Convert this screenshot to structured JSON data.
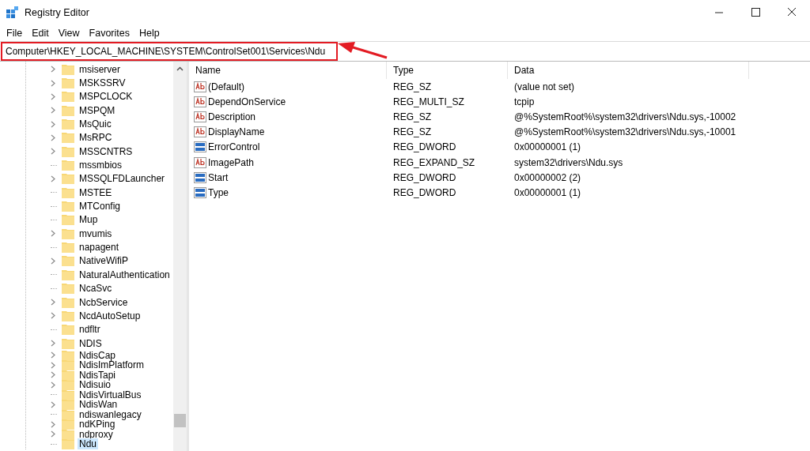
{
  "window": {
    "title": "Registry Editor"
  },
  "menu": [
    "File",
    "Edit",
    "View",
    "Favorites",
    "Help"
  ],
  "address": "Computer\\HKEY_LOCAL_MACHINE\\SYSTEM\\ControlSet001\\Services\\Ndu",
  "tree": [
    {
      "label": "msiserver",
      "expandable": true,
      "selected": false
    },
    {
      "label": "MSKSSRV",
      "expandable": true,
      "selected": false
    },
    {
      "label": "MSPCLOCK",
      "expandable": true,
      "selected": false
    },
    {
      "label": "MSPQM",
      "expandable": true,
      "selected": false
    },
    {
      "label": "MsQuic",
      "expandable": true,
      "selected": false
    },
    {
      "label": "MsRPC",
      "expandable": true,
      "selected": false
    },
    {
      "label": "MSSCNTRS",
      "expandable": true,
      "selected": false
    },
    {
      "label": "mssmbios",
      "expandable": false,
      "selected": false
    },
    {
      "label": "MSSQLFDLauncher",
      "expandable": true,
      "selected": false
    },
    {
      "label": "MSTEE",
      "expandable": false,
      "selected": false
    },
    {
      "label": "MTConfig",
      "expandable": false,
      "selected": false
    },
    {
      "label": "Mup",
      "expandable": false,
      "selected": false
    },
    {
      "label": "mvumis",
      "expandable": true,
      "selected": false
    },
    {
      "label": "napagent",
      "expandable": false,
      "selected": false
    },
    {
      "label": "NativeWifiP",
      "expandable": true,
      "selected": false
    },
    {
      "label": "NaturalAuthentication",
      "expandable": false,
      "selected": false
    },
    {
      "label": "NcaSvc",
      "expandable": false,
      "selected": false
    },
    {
      "label": "NcbService",
      "expandable": true,
      "selected": false
    },
    {
      "label": "NcdAutoSetup",
      "expandable": true,
      "selected": false
    },
    {
      "label": "ndfltr",
      "expandable": false,
      "selected": false
    },
    {
      "label": "NDIS",
      "expandable": true,
      "selected": false
    },
    {
      "label": "NdisCap",
      "expandable": true,
      "selected": false
    },
    {
      "label": "NdisImPlatform",
      "expandable": true,
      "selected": false
    },
    {
      "label": "NdisTapi",
      "expandable": true,
      "selected": false
    },
    {
      "label": "Ndisuio",
      "expandable": true,
      "selected": false
    },
    {
      "label": "NdisVirtualBus",
      "expandable": false,
      "selected": false
    },
    {
      "label": "NdisWan",
      "expandable": true,
      "selected": false
    },
    {
      "label": "ndiswanlegacy",
      "expandable": false,
      "selected": false
    },
    {
      "label": "ndKPing",
      "expandable": true,
      "selected": false
    },
    {
      "label": "ndproxy",
      "expandable": true,
      "selected": false
    },
    {
      "label": "Ndu",
      "expandable": false,
      "selected": true
    }
  ],
  "table": {
    "columns": [
      "Name",
      "Type",
      "Data"
    ],
    "rows": [
      {
        "kind": "string",
        "name": "(Default)",
        "type": "REG_SZ",
        "data": "(value not set)"
      },
      {
        "kind": "string",
        "name": "DependOnService",
        "type": "REG_MULTI_SZ",
        "data": "tcpip"
      },
      {
        "kind": "string",
        "name": "Description",
        "type": "REG_SZ",
        "data": "@%SystemRoot%\\system32\\drivers\\Ndu.sys,-10002"
      },
      {
        "kind": "string",
        "name": "DisplayName",
        "type": "REG_SZ",
        "data": "@%SystemRoot%\\system32\\drivers\\Ndu.sys,-10001"
      },
      {
        "kind": "binary",
        "name": "ErrorControl",
        "type": "REG_DWORD",
        "data": "0x00000001 (1)"
      },
      {
        "kind": "string",
        "name": "ImagePath",
        "type": "REG_EXPAND_SZ",
        "data": "system32\\drivers\\Ndu.sys"
      },
      {
        "kind": "binary",
        "name": "Start",
        "type": "REG_DWORD",
        "data": "0x00000002 (2)"
      },
      {
        "kind": "binary",
        "name": "Type",
        "type": "REG_DWORD",
        "data": "0x00000001 (1)"
      }
    ]
  }
}
